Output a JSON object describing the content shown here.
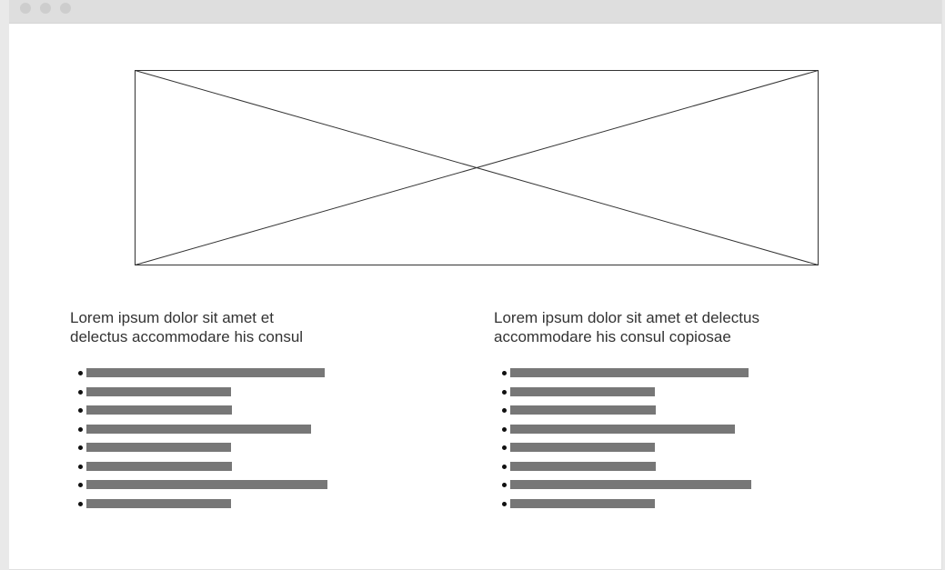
{
  "window": {
    "controls": [
      "close-dot",
      "minimize-dot",
      "maximize-dot"
    ]
  },
  "hero": {
    "placeholder": "image-placeholder"
  },
  "columns": [
    {
      "heading_line1": "Lorem ipsum dolor sit amet et",
      "heading_line2": "delectus accommodare his consul",
      "bullet_count": 8
    },
    {
      "heading_line1": "Lorem ipsum dolor sit amet et delectus",
      "heading_line2": "accommodare his consul copiosae",
      "bullet_count": 8
    }
  ],
  "colors": {
    "titlebar": "#dedede",
    "bar": "#777777",
    "text": "#333333"
  }
}
